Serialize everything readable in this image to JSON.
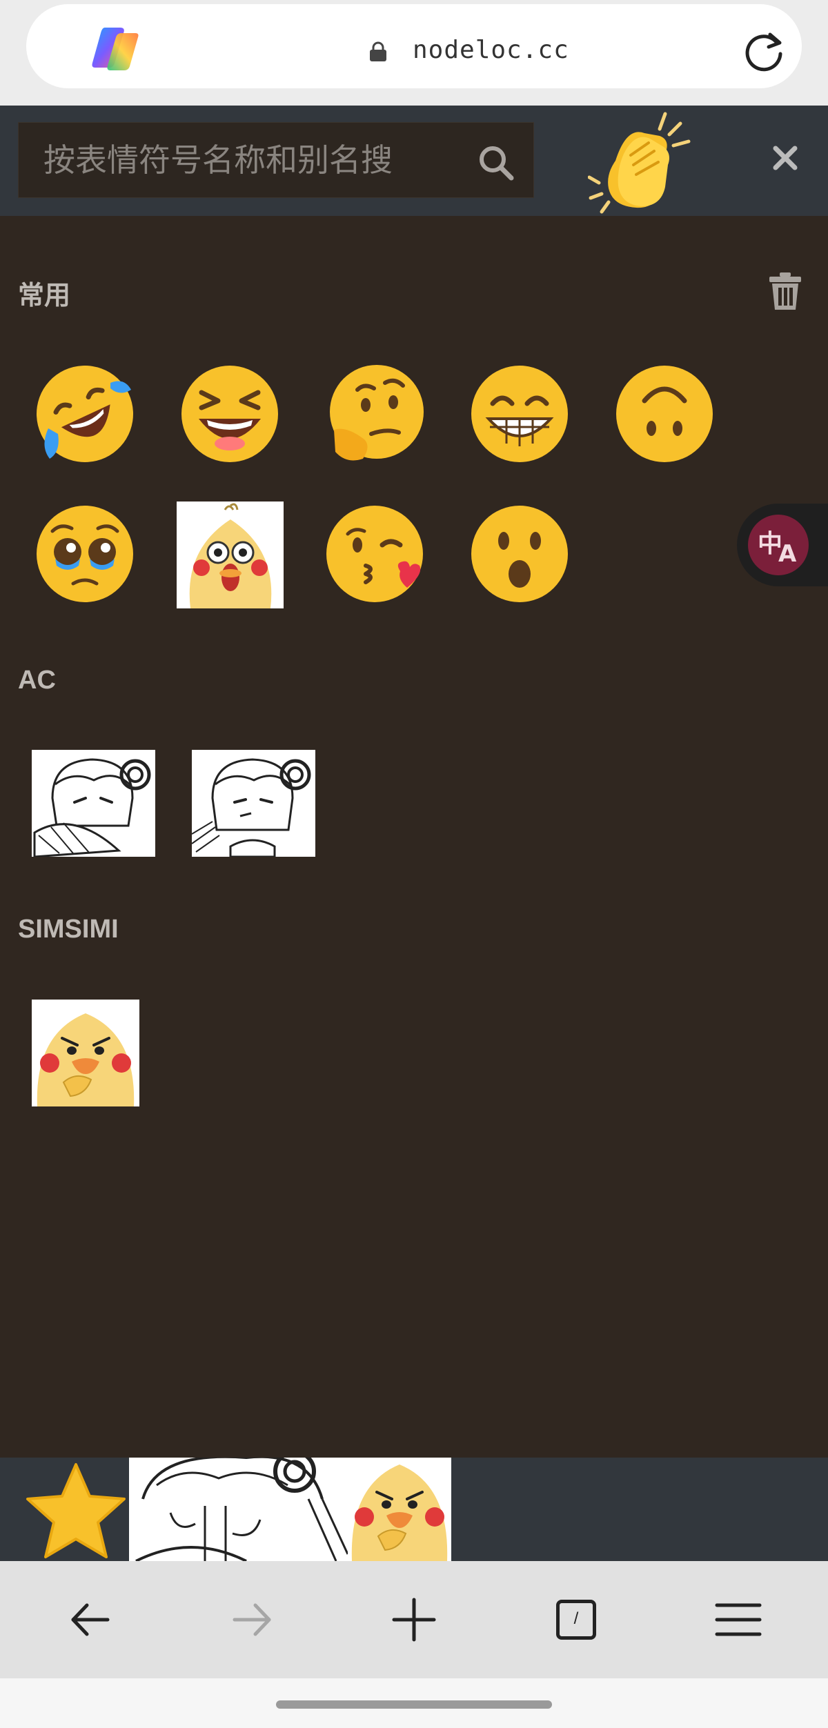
{
  "browser": {
    "url": "nodeloc.cc",
    "icons": {
      "assistant": "copilot-logo-icon",
      "lock": "lock-icon",
      "reload": "reload-icon"
    }
  },
  "picker": {
    "search_placeholder": "按表情符号名称和别名搜",
    "icons": {
      "search": "search-icon",
      "skin_tone": "clapping-hands-icon",
      "close": "close-icon",
      "clear": "trash-icon"
    },
    "sections": [
      {
        "title": "常用",
        "items": [
          "rolling-on-the-floor-laughing",
          "grinning-squinting-face",
          "thinking-face",
          "beaming-face-with-smiling-eyes",
          "upside-down-face",
          "pleading-face",
          "duck-shocked-sticker",
          "face-blowing-a-kiss",
          "face-with-open-mouth"
        ]
      },
      {
        "title": "AC",
        "items": [
          "ac-sticker-fan",
          "ac-sticker-spit"
        ]
      },
      {
        "title": "SIMSIMI",
        "items": [
          "simsimi-duck-sticker"
        ]
      }
    ]
  },
  "favorites": {
    "items": [
      "star-icon",
      "ac-group-thumbnail",
      "simsimi-group-thumbnail"
    ]
  },
  "nav": {
    "items": [
      "back-arrow-icon",
      "forward-arrow-icon",
      "new-tab-plus-icon",
      "tabs-count-icon",
      "menu-icon"
    ],
    "tab_count": "/"
  },
  "colors": {
    "picker_bg": "#302720",
    "header_bg": "#32373d",
    "section_text": "#bfbab5",
    "translate_badge": "#7b1f3a"
  }
}
